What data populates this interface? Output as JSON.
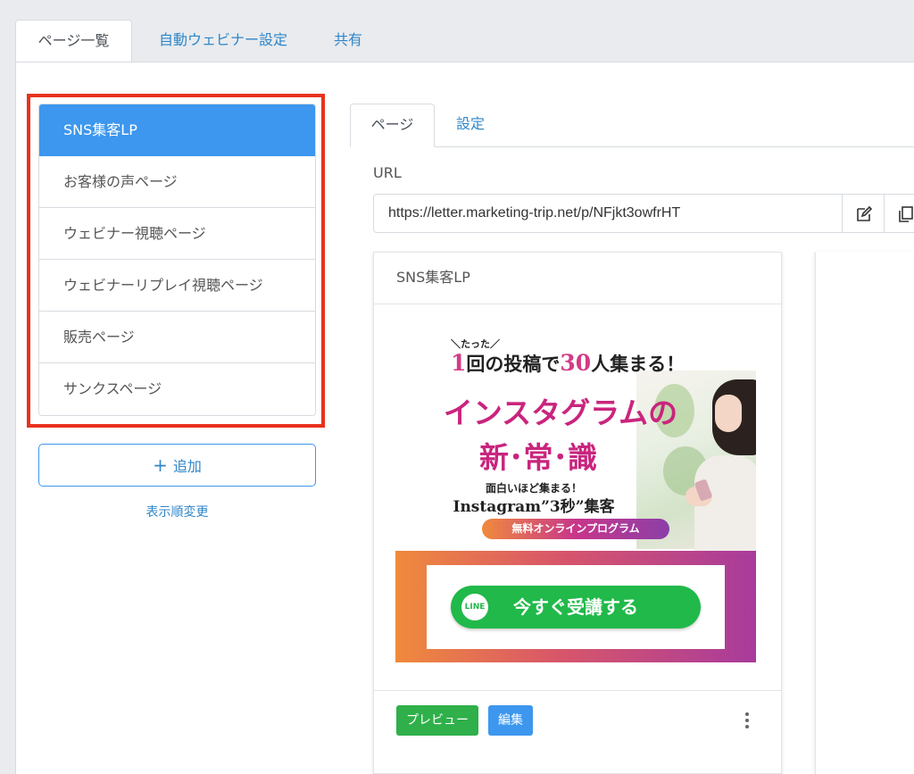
{
  "top_tabs": [
    "ページ一覧",
    "自動ウェビナー設定",
    "共有"
  ],
  "pages_list": {
    "items": [
      "SNS集客LP",
      "お客様の声ページ",
      "ウェビナー視聴ページ",
      "ウェビナーリプレイ視聴ページ",
      "販売ページ",
      "サンクスページ"
    ],
    "active_index": 0
  },
  "add_button": {
    "icon": "+",
    "label": "追加"
  },
  "reorder_link": "表示順変更",
  "detail": {
    "tabs": [
      "ページ",
      "設定"
    ],
    "url_label": "URL",
    "url_value": "https://letter.marketing-trip.net/p/NFjkt3owfrHT",
    "action_icons": [
      "edit-icon",
      "copy-icon"
    ]
  },
  "card": {
    "title": "SNS集客LP",
    "thumbnail": {
      "tagline_small": "＼たった／",
      "line1_pre": "1",
      "line1_mid": "回の投稿で",
      "line1_num": "30",
      "line1_post": "人集まる！",
      "headline1": "インスタグラムの",
      "headline2": "新･常･識",
      "sub1": "面白いほど集まる！",
      "sub2": "Instagram”3秒”集客",
      "pill": "無料オンラインプログラム",
      "cta_icon": "LINE",
      "cta_label": "今すぐ受講する"
    },
    "preview_button": "プレビュー",
    "edit_button": "編集"
  },
  "colors": {
    "accent": "#3d97ee",
    "highlight_border": "#e8321e",
    "preview_green": "#2fb04a",
    "link": "#2f86c8"
  }
}
